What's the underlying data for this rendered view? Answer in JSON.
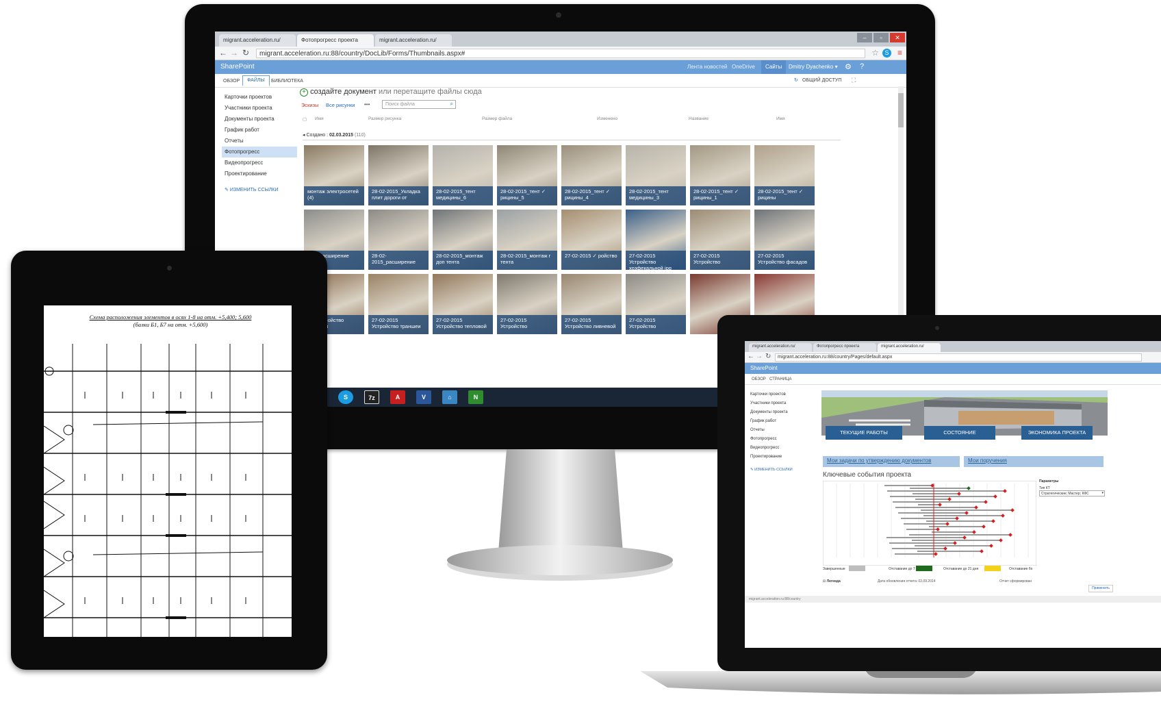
{
  "monitor": {
    "tabs": [
      {
        "label": "migrant.acceleration.ru/"
      },
      {
        "label": "Фотопрогресс проекта"
      },
      {
        "label": "migrant.acceleration.ru/"
      }
    ],
    "url": "migrant.acceleration.ru:88/country/DocLib/Forms/Thumbnails.aspx#",
    "sharepoint": {
      "brand": "SharePoint",
      "top_links": [
        "Лента новостей",
        "OneDrive",
        "Сайты"
      ],
      "user": "Dmitry Dyachenko ▾",
      "ribbon_tabs": [
        "ОБЗОР",
        "ФАЙЛЫ",
        "БИБЛИОТЕКА"
      ],
      "share": "ОБЩИЙ ДОСТУП"
    },
    "quick_launch": [
      "Карточки проектов",
      "Участники проекта",
      "Документы проекта",
      "График работ",
      "Отчеты",
      "Фотопрогресс",
      "Видеопрогресс",
      "Проектирование"
    ],
    "edit_links": "ИЗМЕНИТЬ ССЫЛКИ",
    "new_doc_prefix": "создайте документ",
    "new_doc_suffix": " или перетащите файлы сюда",
    "views": [
      "Эскизы",
      "Все рисунки",
      "•••"
    ],
    "search_placeholder": "Поиск файла",
    "columns": [
      "Имя",
      "Размер рисунка",
      "Размер файла",
      "Изменено",
      "Название",
      "Имя"
    ],
    "group_prefix": "Создано : ",
    "group_date": "02.03.2015",
    "group_count": "(110)",
    "thumbs": [
      {
        "caption": "монтаж электросетей (4)",
        "color": "#8a7a62"
      },
      {
        "caption": "28-02-2015_Укладка плит дороги от",
        "color": "#7d7568"
      },
      {
        "caption": "28-02-2015_тент медицины_6",
        "color": "#b4b2ad"
      },
      {
        "caption": "28-02-2015_тент ✓ рицины_5",
        "color": "#8e8676"
      },
      {
        "caption": "28-02-2015_тент ✓ рицины_4",
        "color": "#9a8f7c"
      },
      {
        "caption": "28-02-2015_тент медицины_3",
        "color": "#b8b4aa"
      },
      {
        "caption": "28-02-2015_тент ✓ рицины_1",
        "color": "#a39884"
      },
      {
        "caption": "28-02-2015_тент ✓ рицины",
        "color": "#b0a28c"
      },
      {
        "caption": "02- _Расширение",
        "color": "#8b8d8b"
      },
      {
        "caption": "28-02- 2015_расширение",
        "color": "#8d8a86"
      },
      {
        "caption": "28-02-2015_монтаж доп тента",
        "color": "#6f7478"
      },
      {
        "caption": "28-02-2015_монтаж г тента",
        "color": "#9aa0a4"
      },
      {
        "caption": "27-02-2015 ✓ ройство",
        "color": "#a58e70"
      },
      {
        "caption": "27-02-2015 Устройство хозфекальной jpg 1428 x 1071 577 KB",
        "color": "#3a5f88"
      },
      {
        "caption": "27-02-2015 Устройство",
        "color": "#9a8b74"
      },
      {
        "caption": "27-02-2015 Устройство фасадов",
        "color": "#6e7378"
      },
      {
        "caption": "2-2015 ройство траншеи",
        "color": "#8a6a4c"
      },
      {
        "caption": "27-02-2015 Устройство траншеи",
        "color": "#9a8264"
      },
      {
        "caption": "27-02-2015 Устройство тепловой",
        "color": "#92785a"
      },
      {
        "caption": "27-02-2015 Устройство",
        "color": "#7e786e"
      },
      {
        "caption": "27-02-2015 Устройство ливневой",
        "color": "#988670"
      },
      {
        "caption": "27-02-2015 Устройство",
        "color": "#8c8a86"
      },
      {
        "caption": "",
        "color": "#7a3a30"
      },
      {
        "caption": "",
        "color": "#8a3a34"
      }
    ],
    "taskbar_icons": [
      "folder-icon",
      "skype-icon",
      "7zip-icon",
      "pdf-icon",
      "visio-icon",
      "network-icon",
      "app-icon"
    ]
  },
  "tablet": {
    "title": "Схема расположения элементов в осях 1-8 на отм. +5,400; 5,600",
    "subtitle": "(балки Б1, Б7 на отм. +5,600)"
  },
  "laptop": {
    "tabs": [
      {
        "label": "migrant.acceleration.ru/"
      },
      {
        "label": "Фотопрогресс проекта"
      },
      {
        "label": "migrant.acceleration.ru/"
      }
    ],
    "url": "migrant.acceleration.ru:88/country/Pages/default.aspx",
    "brand": "SharePoint",
    "ribbon_tabs": [
      "ОБЗОР",
      "СТРАНИЦА"
    ],
    "quick_launch": [
      "Карточки проектов",
      "Участники проекта",
      "Документы проекта",
      "График работ",
      "Отчеты",
      "Фотопрогресс",
      "Видеопрогресс",
      "Проектирование"
    ],
    "edit_links": "ИЗМЕНИТЬ ССЫЛКИ",
    "buttons": [
      "ТЕКУЩИЕ РАБОТЫ",
      "СОСТОЯНИЕ СТРОИТЕЛЬСТВА",
      "ЭКОНОМИКА ПРОЕКТА"
    ],
    "links": [
      "Мои задачи по утверждению документов",
      "Мои поручения"
    ],
    "chart_title": "Ключевые события проекта",
    "params_title": "Параметры",
    "params_type_label": "Тип КТ",
    "params_type_value": "Стратегические; Мастер; КФС",
    "legend_items": [
      "Завершенные",
      "Отставание до 7 дней",
      "Отставание до 21 дня",
      "Отставание бо"
    ],
    "legend_label": "Легенда",
    "updated_label": "Дата обновления отчета: 02.09.2014",
    "report_label": "Отчет сформирован",
    "apply_button": "Применить",
    "status_url": "migrant.acceleration.ru:88/country"
  },
  "colors": {
    "sp_blue": "#6a9fd8",
    "sp_button": "#2a5f94",
    "caption_blue": "#284e78",
    "milestone_red": "#d21f1f",
    "legend_gray": "#bdbdbd",
    "legend_green": "#1e6b1e",
    "legend_yellow": "#f2d21b"
  }
}
